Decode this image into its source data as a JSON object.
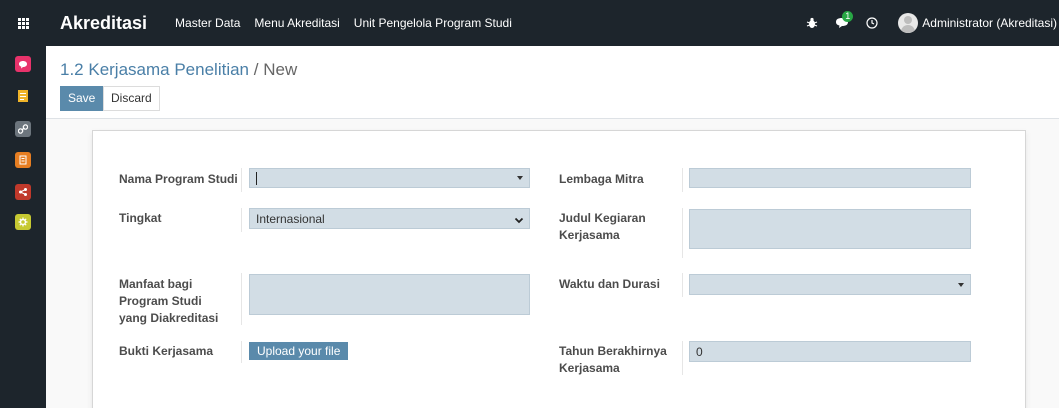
{
  "navbar": {
    "brand": "Akreditasi",
    "menu": [
      "Master Data",
      "Menu Akreditasi",
      "Unit Pengelola Program Studi"
    ],
    "chat_badge": "1",
    "user_name": "Administrator (Akreditasi)"
  },
  "sidebar": {
    "icons": [
      {
        "name": "discuss-icon",
        "color": "#e8336b"
      },
      {
        "name": "notes-icon",
        "color": "#f0b429"
      },
      {
        "name": "link-icon",
        "color": "#6c757d"
      },
      {
        "name": "document-icon",
        "color": "#e67e22"
      },
      {
        "name": "share-icon",
        "color": "#c0392b"
      },
      {
        "name": "settings-icon",
        "color": "#c6c932"
      }
    ]
  },
  "breadcrumb": {
    "parent": "1.2 Kerjasama Penelitian",
    "separator": "/",
    "current": "New"
  },
  "buttons": {
    "save": "Save",
    "discard": "Discard"
  },
  "form": {
    "nama_program_studi": {
      "label": "Nama Program Studi",
      "value": ""
    },
    "tingkat": {
      "label": "Tingkat",
      "value": "Internasional"
    },
    "manfaat": {
      "label": "Manfaat bagi Program Studi yang Diakreditasi",
      "value": ""
    },
    "bukti": {
      "label": "Bukti Kerjasama",
      "button": "Upload your file"
    },
    "lembaga_mitra": {
      "label": "Lembaga Mitra",
      "value": ""
    },
    "judul": {
      "label": "Judul Kegiaran Kerjasama",
      "value": ""
    },
    "waktu": {
      "label": "Waktu dan Durasi",
      "value": ""
    },
    "tahun": {
      "label": "Tahun Berakhirnya Kerjasama",
      "value": "0"
    }
  }
}
